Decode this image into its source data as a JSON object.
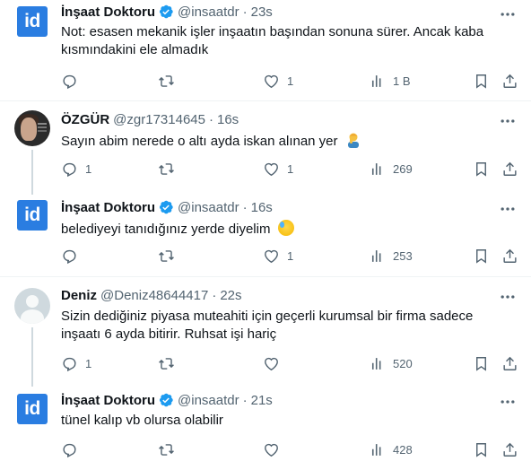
{
  "tweets": [
    {
      "name": "İnşaat Doktoru",
      "handle": "@insaatdr",
      "time": "23s",
      "text": "Not: esasen mekanik işler inşaatın başından sonuna sürer. Ancak kaba kısmındakini ele almadık",
      "avatar": "id",
      "avatar_text": "id",
      "replies": "",
      "likes": "1",
      "views": "1 B"
    },
    {
      "name": "ÖZGÜR",
      "handle": "@zgr17314645",
      "time": "16s",
      "text": "Sayın abim nerede o altı ayda iskan alınan yer",
      "avatar": "photo",
      "replies": "1",
      "likes": "1",
      "views": "269"
    },
    {
      "name": "İnşaat Doktoru",
      "handle": "@insaatdr",
      "time": "16s",
      "text": "belediyeyi tanıdığınız yerde diyelim",
      "avatar": "id",
      "avatar_text": "id",
      "replies": "",
      "likes": "1",
      "views": "253"
    },
    {
      "name": "Deniz",
      "handle": "@Deniz48644417",
      "time": "22s",
      "text": "Sizin dediğiniz piyasa muteahiti için geçerli kurumsal bir firma sadece inşaatı 6 ayda bitirir. Ruhsat işi hariç",
      "avatar": "default",
      "replies": "1",
      "likes": "",
      "views": "520"
    },
    {
      "name": "İnşaat Doktoru",
      "handle": "@insaatdr",
      "time": "21s",
      "text": "tünel kalıp vb olursa olabilir",
      "avatar": "id",
      "avatar_text": "id",
      "replies": "",
      "likes": "",
      "views": "428"
    }
  ],
  "separator": "·",
  "colors": {
    "verified": "#1d9bf0",
    "muted": "#536471",
    "text": "#0f1419",
    "id_logo": "#2a7de1"
  },
  "icons": [
    "more-icon",
    "reply-icon",
    "retweet-icon",
    "like-icon",
    "views-icon",
    "bookmark-icon",
    "share-icon",
    "verified-badge-icon"
  ]
}
